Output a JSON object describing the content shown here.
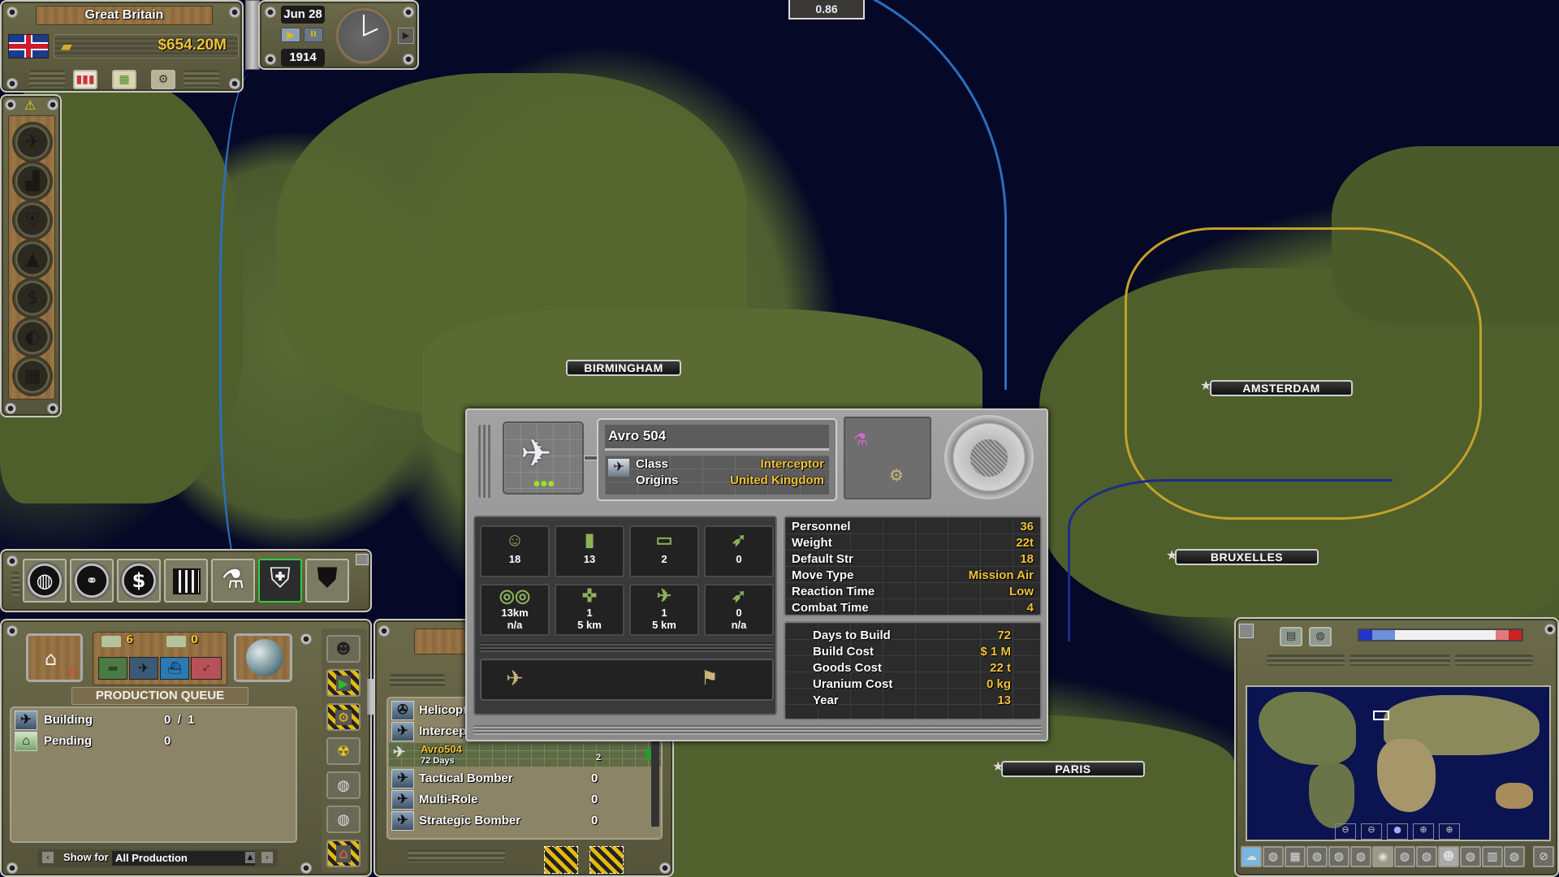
{
  "country": {
    "name": "Great Britain",
    "treasury": "$654.20M",
    "flag": "union-jack"
  },
  "top_bar_buttons": [
    "statistics-chart-icon",
    "calendar-icon",
    "computer-settings-icon"
  ],
  "time": {
    "date": "Jun 28",
    "year": "1914",
    "play_label": "▶",
    "pause_label": "II",
    "next_label": "▶"
  },
  "game_speed": "0.86",
  "alert_icon": "⚠",
  "side_advisors": [
    "aircraft",
    "industry",
    "defense",
    "resources",
    "finance",
    "diplomacy",
    "grid"
  ],
  "map": {
    "cities": [
      {
        "name": "BIRMINGHAM",
        "capital": false
      },
      {
        "name": "AMSTERDAM",
        "capital": true
      },
      {
        "name": "BRUXELLES",
        "capital": true
      },
      {
        "name": "PARIS",
        "capital": true
      }
    ]
  },
  "main_toolbar": {
    "buttons": [
      {
        "name": "world",
        "glyph": "🌐"
      },
      {
        "name": "diplomacy",
        "glyph": "🤝"
      },
      {
        "name": "finance",
        "glyph": "$"
      },
      {
        "name": "supplies",
        "glyph": "▦"
      },
      {
        "name": "research",
        "glyph": "⚗"
      },
      {
        "name": "production",
        "glyph": "🔧",
        "active": true
      },
      {
        "name": "military",
        "glyph": "▶"
      }
    ]
  },
  "production": {
    "counts": {
      "new": "6",
      "upgrade": "0"
    },
    "categories": [
      "land",
      "air",
      "sea",
      "missile"
    ],
    "queue_title": "PRODUCTION QUEUE",
    "building_label": "Building",
    "building_value": "0  /  1",
    "pending_label": "Pending",
    "pending_value": "0",
    "show_for_label": "Show for",
    "show_for_value": "All Production"
  },
  "unit_list": {
    "rows": [
      {
        "label": "Helicopt",
        "value": ""
      },
      {
        "label": "Intercept",
        "value": ""
      },
      {
        "label": "Tactical Bomber",
        "value": "0"
      },
      {
        "label": "Multi-Role",
        "value": "0"
      },
      {
        "label": "Strategic Bomber",
        "value": "0"
      }
    ],
    "selected": {
      "name": "Avro504",
      "days": "72 Days",
      "count": "2"
    }
  },
  "unit_card": {
    "name": "Avro 504",
    "class_label": "Class",
    "class_value": "Interceptor",
    "origins_label": "Origins",
    "origins_value": "United Kingdom",
    "stat_cells": [
      {
        "icon": "personnel-icon",
        "value": "18",
        "sub": ""
      },
      {
        "icon": "fuel-icon",
        "value": "13",
        "sub": ""
      },
      {
        "icon": "supply-icon",
        "value": "2",
        "sub": ""
      },
      {
        "icon": "missile-icon",
        "value": "0",
        "sub": ""
      },
      {
        "icon": "binoculars-icon",
        "value": "13km",
        "sub": "n/a"
      },
      {
        "icon": "ground-attack-icon",
        "value": "1",
        "sub": "5 km"
      },
      {
        "icon": "air-attack-icon",
        "value": "1",
        "sub": "5 km"
      },
      {
        "icon": "missile-range-icon",
        "value": "0",
        "sub": "n/a"
      }
    ],
    "stats": [
      {
        "label": "Personnel",
        "value": "36"
      },
      {
        "label": "Weight",
        "value": "22t"
      },
      {
        "label": "Default Str",
        "value": "18"
      },
      {
        "label": "Move Type",
        "value": "Mission Air"
      },
      {
        "label": "Reaction Time",
        "value": "Low"
      },
      {
        "label": "Combat Time",
        "value": "4"
      }
    ],
    "costs": [
      {
        "label": "Days to Build",
        "value": "72"
      },
      {
        "label": "Build Cost",
        "value": "$ 1 M"
      },
      {
        "label": "Goods Cost",
        "value": "22 t"
      },
      {
        "label": "Uranium Cost",
        "value": "0 kg"
      },
      {
        "label": "Year",
        "value": "13"
      }
    ]
  },
  "minimap": {
    "zoom_buttons": [
      "zoom-out-max",
      "zoom-out",
      "zoom-reset",
      "zoom-in",
      "zoom-in-max"
    ],
    "bottom_buttons": [
      "weather",
      "map-mode-1",
      "map-mode-grid",
      "map-mode-3",
      "map-mode-4",
      "map-mode-5",
      "map-mode-6",
      "map-mode-7",
      "map-mode-8",
      "map-mode-9",
      "map-mode-10",
      "map-mode-11",
      "map-mode-12",
      "disable"
    ],
    "colors": {
      "blue": "#2233cc",
      "red": "#cc2222"
    }
  },
  "colors": {
    "gold": "#f2c33a",
    "olive": "#5f5e42",
    "steel": "#8e8e8e",
    "sea": "#050826",
    "land": "#4f5f2f"
  }
}
